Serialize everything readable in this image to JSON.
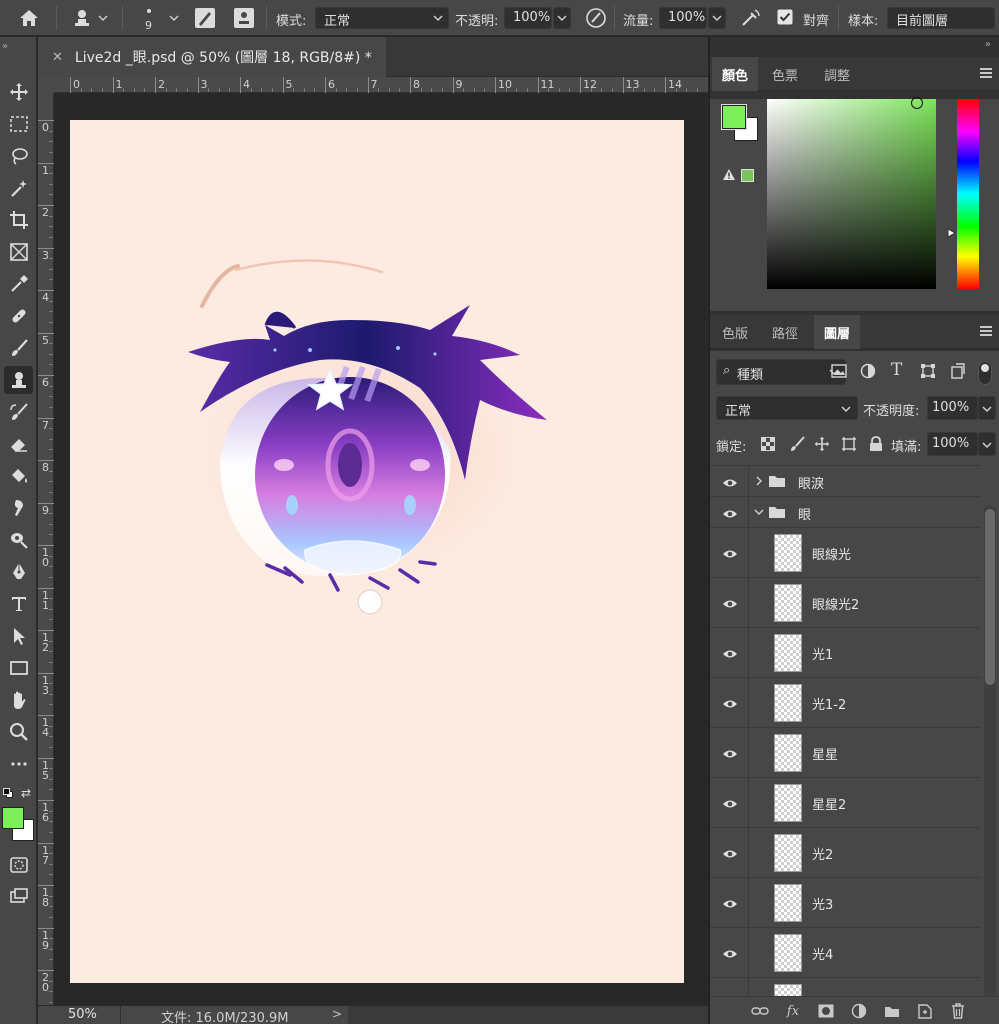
{
  "options_bar": {
    "brush_size": "9",
    "mode_label": "模式:",
    "mode_value": "正常",
    "opacity_label": "不透明:",
    "opacity_value": "100%",
    "flow_label": "流量:",
    "flow_value": "100%",
    "aligned_label": "對齊",
    "aligned_checked": true,
    "sample_label": "樣本:",
    "sample_value": "目前圖層"
  },
  "document": {
    "tab_title": "Live2d _眼.psd @ 50% (圖層 18, RGB/8#) *",
    "zoom": "50%",
    "doc_info": "文件: 16.0M/230.9M",
    "ruler_h": [
      "0",
      "1",
      "2",
      "3",
      "4",
      "5",
      "6",
      "7",
      "8",
      "9",
      "10",
      "11",
      "12",
      "13",
      "14"
    ],
    "ruler_v": [
      "0",
      "1",
      "2",
      "3",
      "4",
      "5",
      "6",
      "7",
      "8",
      "9",
      "1\n0",
      "1\n1",
      "1\n2",
      "1\n3",
      "1\n4",
      "1\n5",
      "1\n6",
      "1\n7",
      "1\n8",
      "1\n9",
      "2\n0"
    ]
  },
  "colors": {
    "foreground": "#7cf05a",
    "background": "#ffffff",
    "canvas": "#fcebe1",
    "hue": "#7ce35a",
    "websafe_swatch": "#7cc55a"
  },
  "color_panel": {
    "tabs": [
      "顏色",
      "色票",
      "調整"
    ],
    "active_tab": 0
  },
  "layers_panel": {
    "tabs": [
      "色版",
      "路徑",
      "圖層"
    ],
    "active_tab": 2,
    "filter_kind": "種類",
    "blend_mode": "正常",
    "opacity_label": "不透明度:",
    "opacity_value": "100%",
    "lock_label": "鎖定:",
    "fill_label": "填滿:",
    "fill_value": "100%",
    "layers": [
      {
        "name": "眼淚",
        "type": "group",
        "expanded": false,
        "indent": 0
      },
      {
        "name": "眼",
        "type": "group",
        "expanded": true,
        "indent": 0
      },
      {
        "name": "眼線光",
        "type": "layer",
        "indent": 1
      },
      {
        "name": "眼線光2",
        "type": "layer",
        "indent": 1
      },
      {
        "name": "光1",
        "type": "layer",
        "indent": 1
      },
      {
        "name": "光1-2",
        "type": "layer",
        "indent": 1
      },
      {
        "name": "星星",
        "type": "layer",
        "indent": 1
      },
      {
        "name": "星星2",
        "type": "layer",
        "indent": 1
      },
      {
        "name": "光2",
        "type": "layer",
        "indent": 1
      },
      {
        "name": "光3",
        "type": "layer",
        "indent": 1
      },
      {
        "name": "光4",
        "type": "layer",
        "indent": 1
      }
    ]
  },
  "tools": [
    "home-icon",
    "move-tool",
    "marquee-tool",
    "lasso-tool",
    "magic-wand-tool",
    "crop-tool",
    "frame-tool",
    "eyedropper-tool",
    "healing-brush-tool",
    "brush-tool",
    "clone-stamp-tool",
    "history-brush-tool",
    "eraser-tool",
    "paint-bucket-tool",
    "smudge-tool",
    "dodge-tool",
    "pen-tool",
    "type-tool",
    "path-selection-tool",
    "rectangle-tool",
    "hand-tool",
    "zoom-tool",
    "more-tools",
    "quick-mask",
    "screen-mode"
  ]
}
